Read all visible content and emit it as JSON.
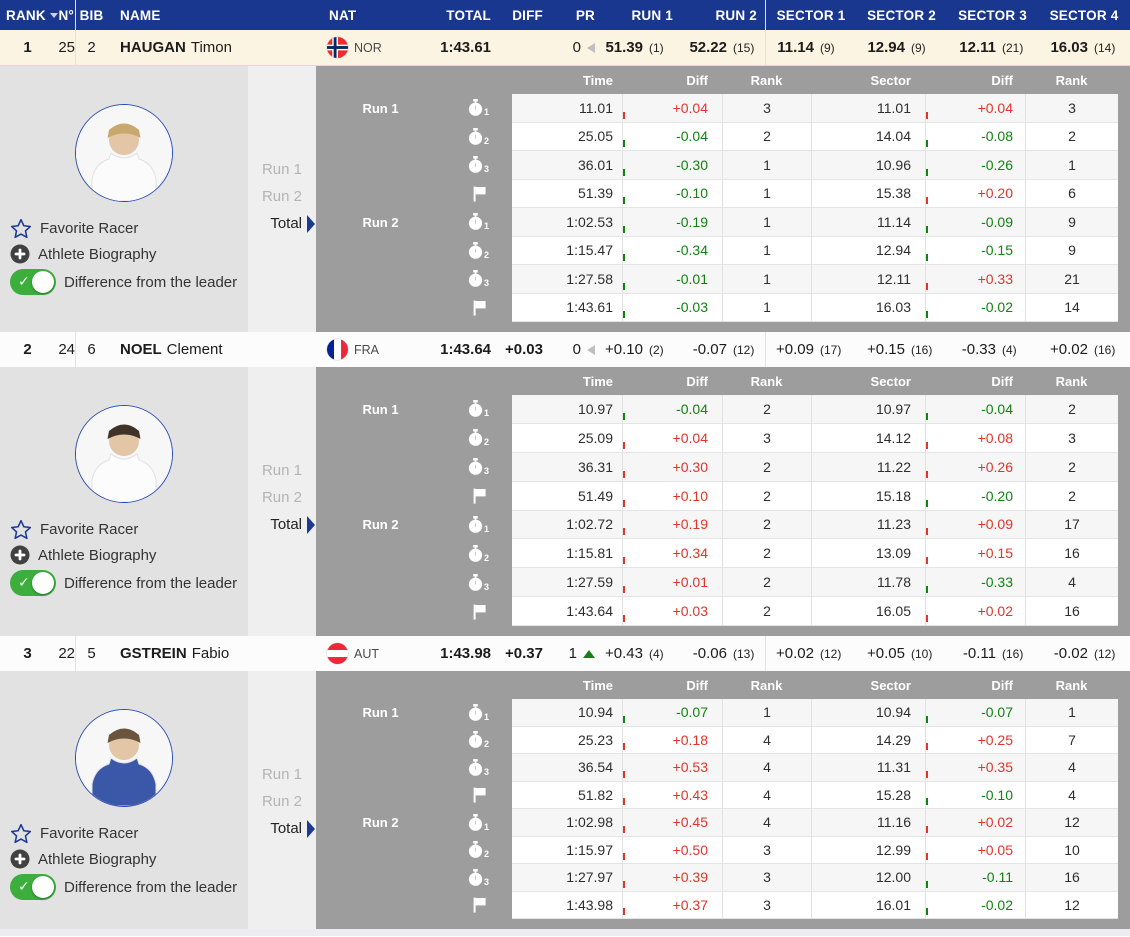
{
  "columns": {
    "rank": "RANK",
    "no": "N°",
    "bib": "BIB",
    "name": "NAME",
    "nat": "NAT",
    "total": "TOTAL",
    "diff": "DIFF",
    "pr": "PR",
    "run1": "RUN 1",
    "run2": "RUN 2",
    "sector1": "SECTOR 1",
    "sector2": "SECTOR 2",
    "sector3": "SECTOR 3",
    "sector4": "SECTOR 4"
  },
  "detail_columns": {
    "time": "Time",
    "diff": "Diff",
    "rank": "Rank",
    "sector": "Sector",
    "diff2": "Diff",
    "rank2": "Rank"
  },
  "side_panel": {
    "favorite": "Favorite Racer",
    "biography": "Athlete Biography",
    "difference": "Difference from the leader"
  },
  "selector": {
    "run1": "Run 1",
    "run2": "Run 2",
    "total": "Total"
  },
  "colors": {
    "header_blue": "#1A378F",
    "accent_blue": "#1A3A94",
    "highlight_row": "#FCF4E2",
    "highlight_border": "#EDDCB0",
    "positive_red": "#E1352C",
    "negative_green": "#108310",
    "panel_gray": "#9D9D9D",
    "info_gray": "#E2E2E2",
    "selector_gray": "#EFEFEF",
    "toggle_green": "#3CAE3C"
  },
  "racers": [
    {
      "rank": "1",
      "no": "25",
      "bib": "2",
      "last_name": "HAUGAN",
      "first_name": "Timon",
      "nat": "NOR",
      "total": "1:43.61",
      "diff": "",
      "pr": "0",
      "pr_arrow": "left",
      "run1": {
        "value": "51.39",
        "rank": "(1)"
      },
      "run2": {
        "value": "52.22",
        "rank": "(15)"
      },
      "sectors": [
        {
          "value": "11.14",
          "rank": "(9)"
        },
        {
          "value": "12.94",
          "rank": "(9)"
        },
        {
          "value": "12.11",
          "rank": "(21)"
        },
        {
          "value": "16.03",
          "rank": "(14)"
        }
      ],
      "detail": [
        {
          "run_label": "Run 1",
          "icon": "interm1",
          "time": "11.01",
          "time_diff": "+0.04",
          "time_rank": "3",
          "sector": "11.01",
          "sector_diff": "+0.04",
          "sector_rank": "3"
        },
        {
          "run_label": "",
          "icon": "interm2",
          "time": "25.05",
          "time_diff": "-0.04",
          "time_rank": "2",
          "sector": "14.04",
          "sector_diff": "-0.08",
          "sector_rank": "2"
        },
        {
          "run_label": "",
          "icon": "interm3",
          "time": "36.01",
          "time_diff": "-0.30",
          "time_rank": "1",
          "sector": "10.96",
          "sector_diff": "-0.26",
          "sector_rank": "1"
        },
        {
          "run_label": "",
          "icon": "finish",
          "time": "51.39",
          "time_diff": "-0.10",
          "time_rank": "1",
          "sector": "15.38",
          "sector_diff": "+0.20",
          "sector_rank": "6"
        },
        {
          "run_label": "Run 2",
          "icon": "interm1",
          "time": "1:02.53",
          "time_diff": "-0.19",
          "time_rank": "1",
          "sector": "11.14",
          "sector_diff": "-0.09",
          "sector_rank": "9"
        },
        {
          "run_label": "",
          "icon": "interm2",
          "time": "1:15.47",
          "time_diff": "-0.34",
          "time_rank": "1",
          "sector": "12.94",
          "sector_diff": "-0.15",
          "sector_rank": "9"
        },
        {
          "run_label": "",
          "icon": "interm3",
          "time": "1:27.58",
          "time_diff": "-0.01",
          "time_rank": "1",
          "sector": "12.11",
          "sector_diff": "+0.33",
          "sector_rank": "21"
        },
        {
          "run_label": "",
          "icon": "finish",
          "time": "1:43.61",
          "time_diff": "-0.03",
          "time_rank": "1",
          "sector": "16.03",
          "sector_diff": "-0.02",
          "sector_rank": "14"
        }
      ]
    },
    {
      "rank": "2",
      "no": "24",
      "bib": "6",
      "last_name": "NOEL",
      "first_name": "Clement",
      "nat": "FRA",
      "total": "1:43.64",
      "diff": "+0.03",
      "pr": "0",
      "pr_arrow": "left",
      "run1": {
        "value": "+0.10",
        "rank": "(2)"
      },
      "run2": {
        "value": "-0.07",
        "rank": "(12)"
      },
      "sectors": [
        {
          "value": "+0.09",
          "rank": "(17)"
        },
        {
          "value": "+0.15",
          "rank": "(16)"
        },
        {
          "value": "-0.33",
          "rank": "(4)"
        },
        {
          "value": "+0.02",
          "rank": "(16)"
        }
      ],
      "detail": [
        {
          "run_label": "Run 1",
          "icon": "interm1",
          "time": "10.97",
          "time_diff": "-0.04",
          "time_rank": "2",
          "sector": "10.97",
          "sector_diff": "-0.04",
          "sector_rank": "2"
        },
        {
          "run_label": "",
          "icon": "interm2",
          "time": "25.09",
          "time_diff": "+0.04",
          "time_rank": "3",
          "sector": "14.12",
          "sector_diff": "+0.08",
          "sector_rank": "3"
        },
        {
          "run_label": "",
          "icon": "interm3",
          "time": "36.31",
          "time_diff": "+0.30",
          "time_rank": "2",
          "sector": "11.22",
          "sector_diff": "+0.26",
          "sector_rank": "2"
        },
        {
          "run_label": "",
          "icon": "finish",
          "time": "51.49",
          "time_diff": "+0.10",
          "time_rank": "2",
          "sector": "15.18",
          "sector_diff": "-0.20",
          "sector_rank": "2"
        },
        {
          "run_label": "Run 2",
          "icon": "interm1",
          "time": "1:02.72",
          "time_diff": "+0.19",
          "time_rank": "2",
          "sector": "11.23",
          "sector_diff": "+0.09",
          "sector_rank": "17"
        },
        {
          "run_label": "",
          "icon": "interm2",
          "time": "1:15.81",
          "time_diff": "+0.34",
          "time_rank": "2",
          "sector": "13.09",
          "sector_diff": "+0.15",
          "sector_rank": "16"
        },
        {
          "run_label": "",
          "icon": "interm3",
          "time": "1:27.59",
          "time_diff": "+0.01",
          "time_rank": "2",
          "sector": "11.78",
          "sector_diff": "-0.33",
          "sector_rank": "4"
        },
        {
          "run_label": "",
          "icon": "finish",
          "time": "1:43.64",
          "time_diff": "+0.03",
          "time_rank": "2",
          "sector": "16.05",
          "sector_diff": "+0.02",
          "sector_rank": "16"
        }
      ]
    },
    {
      "rank": "3",
      "no": "22",
      "bib": "5",
      "last_name": "GSTREIN",
      "first_name": "Fabio",
      "nat": "AUT",
      "total": "1:43.98",
      "diff": "+0.37",
      "pr": "1",
      "pr_arrow": "up",
      "run1": {
        "value": "+0.43",
        "rank": "(4)"
      },
      "run2": {
        "value": "-0.06",
        "rank": "(13)"
      },
      "sectors": [
        {
          "value": "+0.02",
          "rank": "(12)"
        },
        {
          "value": "+0.05",
          "rank": "(10)"
        },
        {
          "value": "-0.11",
          "rank": "(16)"
        },
        {
          "value": "-0.02",
          "rank": "(12)"
        }
      ],
      "detail": [
        {
          "run_label": "Run 1",
          "icon": "interm1",
          "time": "10.94",
          "time_diff": "-0.07",
          "time_rank": "1",
          "sector": "10.94",
          "sector_diff": "-0.07",
          "sector_rank": "1"
        },
        {
          "run_label": "",
          "icon": "interm2",
          "time": "25.23",
          "time_diff": "+0.18",
          "time_rank": "4",
          "sector": "14.29",
          "sector_diff": "+0.25",
          "sector_rank": "7"
        },
        {
          "run_label": "",
          "icon": "interm3",
          "time": "36.54",
          "time_diff": "+0.53",
          "time_rank": "4",
          "sector": "11.31",
          "sector_diff": "+0.35",
          "sector_rank": "4"
        },
        {
          "run_label": "",
          "icon": "finish",
          "time": "51.82",
          "time_diff": "+0.43",
          "time_rank": "4",
          "sector": "15.28",
          "sector_diff": "-0.10",
          "sector_rank": "4"
        },
        {
          "run_label": "Run 2",
          "icon": "interm1",
          "time": "1:02.98",
          "time_diff": "+0.45",
          "time_rank": "4",
          "sector": "11.16",
          "sector_diff": "+0.02",
          "sector_rank": "12"
        },
        {
          "run_label": "",
          "icon": "interm2",
          "time": "1:15.97",
          "time_diff": "+0.50",
          "time_rank": "3",
          "sector": "12.99",
          "sector_diff": "+0.05",
          "sector_rank": "10"
        },
        {
          "run_label": "",
          "icon": "interm3",
          "time": "1:27.97",
          "time_diff": "+0.39",
          "time_rank": "3",
          "sector": "12.00",
          "sector_diff": "-0.11",
          "sector_rank": "16"
        },
        {
          "run_label": "",
          "icon": "finish",
          "time": "1:43.98",
          "time_diff": "+0.37",
          "time_rank": "3",
          "sector": "16.01",
          "sector_diff": "-0.02",
          "sector_rank": "12"
        }
      ]
    }
  ]
}
